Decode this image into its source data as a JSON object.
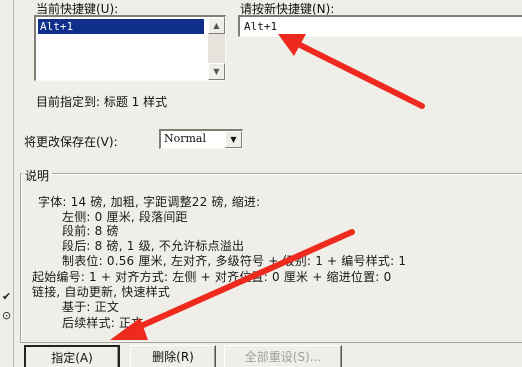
{
  "left_edge_marks": [
    "✔",
    "⊙"
  ],
  "current_keys": {
    "label": "当前快捷键(U):",
    "items": [
      "Alt+1"
    ]
  },
  "new_key": {
    "label": "请按新快捷键(N):",
    "value": "Alt+1"
  },
  "assigned_to": "目前指定到: 标题 1 样式",
  "save_in": {
    "label": "将更改保存在(V):",
    "value": "Normal"
  },
  "description": {
    "title": "说明",
    "lines": [
      "字体: 14 磅, 加粗, 字距调整22 磅, 缩进:",
      "左侧: 0 厘米, 段落间距",
      "段前: 8 磅",
      "段后: 8 磅, 1 级, 不允许标点溢出",
      "制表位: 0.56 厘米, 左对齐, 多级符号 + 级别: 1 + 编号样式: 1",
      "起始编号: 1 + 对齐方式: 左侧 + 对齐位置: 0 厘米 + 缩进位置: 0",
      "链接, 自动更新, 快速样式",
      "基于: 正文",
      "后续样式: 正文"
    ]
  },
  "buttons": {
    "assign": "指定(A)",
    "remove": "删除(R)",
    "reset_all": "全部重设(S)..."
  },
  "accent_colors": {
    "selection": "#0f2f8a",
    "annotation_arrow": "#ee2a1f"
  }
}
